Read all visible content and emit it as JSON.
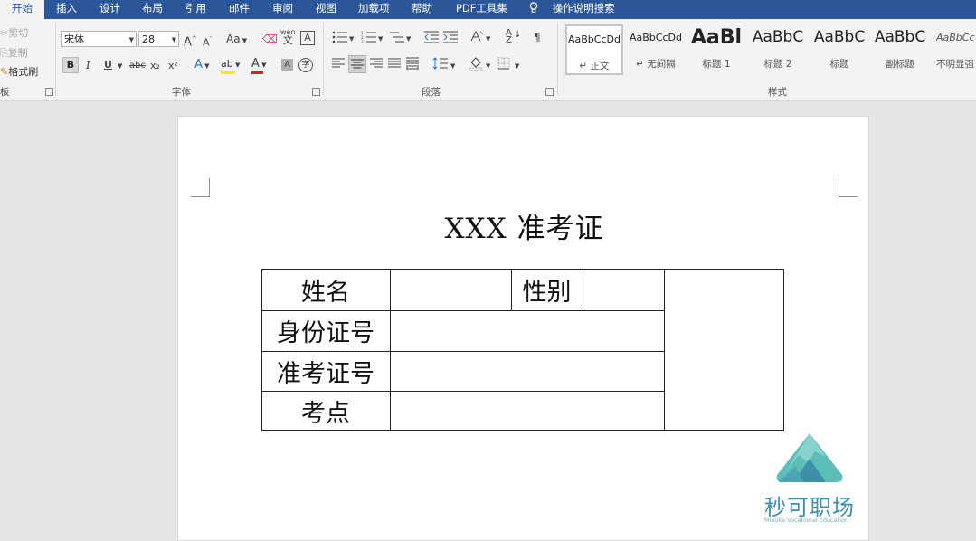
{
  "tabs": [
    {
      "label": "开始",
      "active": true
    },
    {
      "label": "插入"
    },
    {
      "label": "设计"
    },
    {
      "label": "布局"
    },
    {
      "label": "引用"
    },
    {
      "label": "邮件"
    },
    {
      "label": "审阅"
    },
    {
      "label": "视图"
    },
    {
      "label": "加载项"
    },
    {
      "label": "帮助"
    },
    {
      "label": "PDF工具集"
    }
  ],
  "tell_me": {
    "icon": "lightbulb-icon",
    "label": "操作说明搜索"
  },
  "clipboard": {
    "cut": "剪切",
    "copy": "复制",
    "format_painter": "格式刷",
    "group": "板"
  },
  "font": {
    "name": "宋体",
    "size": "28",
    "group": "字体",
    "grow": "A",
    "shrink": "A",
    "case": "Aa",
    "phonetic": "wén",
    "bold": "B",
    "italic": "I",
    "underline": "U",
    "strike": "abc",
    "sub": "x₂",
    "sup": "x²",
    "effects": "A",
    "highlight": "ab",
    "color": "A",
    "shade": "A",
    "enclose": "字"
  },
  "paragraph": {
    "group": "段落"
  },
  "styles": {
    "group": "样式",
    "items": [
      {
        "sample": "AaBbCcDd",
        "name": "↵ 正文",
        "selected": true
      },
      {
        "sample": "AaBbCcDd",
        "name": "↵ 无间隔"
      },
      {
        "sample": "AaBl",
        "name": "标题 1"
      },
      {
        "sample": "AaBbC",
        "name": "标题 2"
      },
      {
        "sample": "AaBbC",
        "name": "标题"
      },
      {
        "sample": "AaBbC",
        "name": "副标题"
      },
      {
        "sample": "AaBbCc",
        "name": "不明显强"
      }
    ]
  },
  "document": {
    "title": "XXX 准考证",
    "rows": [
      {
        "label": "姓名",
        "extra_label": "性别"
      },
      {
        "label": "身份证号"
      },
      {
        "label": "准考证号"
      },
      {
        "label": "考点"
      }
    ]
  },
  "watermark": {
    "name": "秒可职场",
    "tagline": "Miaoke Vocational Education",
    "colors": {
      "primary": "#3e8fa9",
      "accent": "#5bbfb8"
    }
  },
  "colors": {
    "tabbar": "#2b579a",
    "ribbon": "#f3f3f3",
    "canvas": "#e6e6e6",
    "font_color_bar": "#e02020",
    "highlight_bar": "#ffe600"
  }
}
